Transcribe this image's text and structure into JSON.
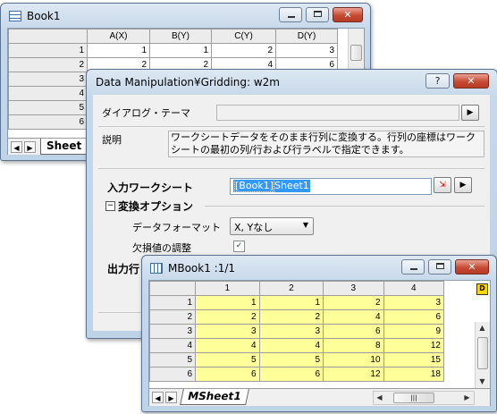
{
  "book1": {
    "title": "Book1",
    "columns": [
      "A(X)",
      "B(Y)",
      "C(Y)",
      "D(Y)"
    ],
    "rows": [
      {
        "n": "1",
        "vals": [
          "1",
          "1",
          "2",
          "3"
        ]
      },
      {
        "n": "2",
        "vals": [
          "2",
          "2",
          "4",
          "6"
        ]
      },
      {
        "n": "3",
        "vals": [
          "",
          "",
          "",
          ""
        ]
      },
      {
        "n": "4",
        "vals": [
          "",
          "",
          "",
          ""
        ]
      },
      {
        "n": "5",
        "vals": [
          "",
          "",
          "",
          ""
        ]
      },
      {
        "n": "6",
        "vals": [
          "",
          "",
          "",
          ""
        ]
      }
    ],
    "sheet_tab": "Sheet"
  },
  "dialog": {
    "title": "Data Manipulation¥Gridding: w2m",
    "help_button": "?",
    "theme_label": "ダイアログ・テーマ",
    "theme_value": "",
    "desc_label": "説明",
    "description": "ワークシートデータをそのまま行列に変換する。行列の座標はワークシートの最初の列/行および行ラベルで指定できます。",
    "input_ws_label": "入力ワークシート",
    "input_ws_book": "[Book1]",
    "input_ws_sheet": "Sheet1",
    "convert_options_label": "変換オプション",
    "collapse_symbol": "−",
    "data_format_label": "データフォーマット",
    "data_format_value": "X, Yなし",
    "missing_label": "欠損値の調整",
    "missing_checked": true,
    "output_label": "出力行"
  },
  "mbook": {
    "title": "MBook1 :1/1",
    "badge": "D",
    "columns": [
      "1",
      "2",
      "3",
      "4"
    ],
    "rows": [
      {
        "n": "1",
        "vals": [
          "1",
          "1",
          "2",
          "3"
        ]
      },
      {
        "n": "2",
        "vals": [
          "2",
          "2",
          "4",
          "6"
        ]
      },
      {
        "n": "3",
        "vals": [
          "3",
          "3",
          "6",
          "9"
        ]
      },
      {
        "n": "4",
        "vals": [
          "4",
          "4",
          "8",
          "12"
        ]
      },
      {
        "n": "5",
        "vals": [
          "5",
          "5",
          "10",
          "15"
        ]
      },
      {
        "n": "6",
        "vals": [
          "6",
          "6",
          "12",
          "18"
        ]
      }
    ],
    "sheet_tab": "MSheet1"
  }
}
